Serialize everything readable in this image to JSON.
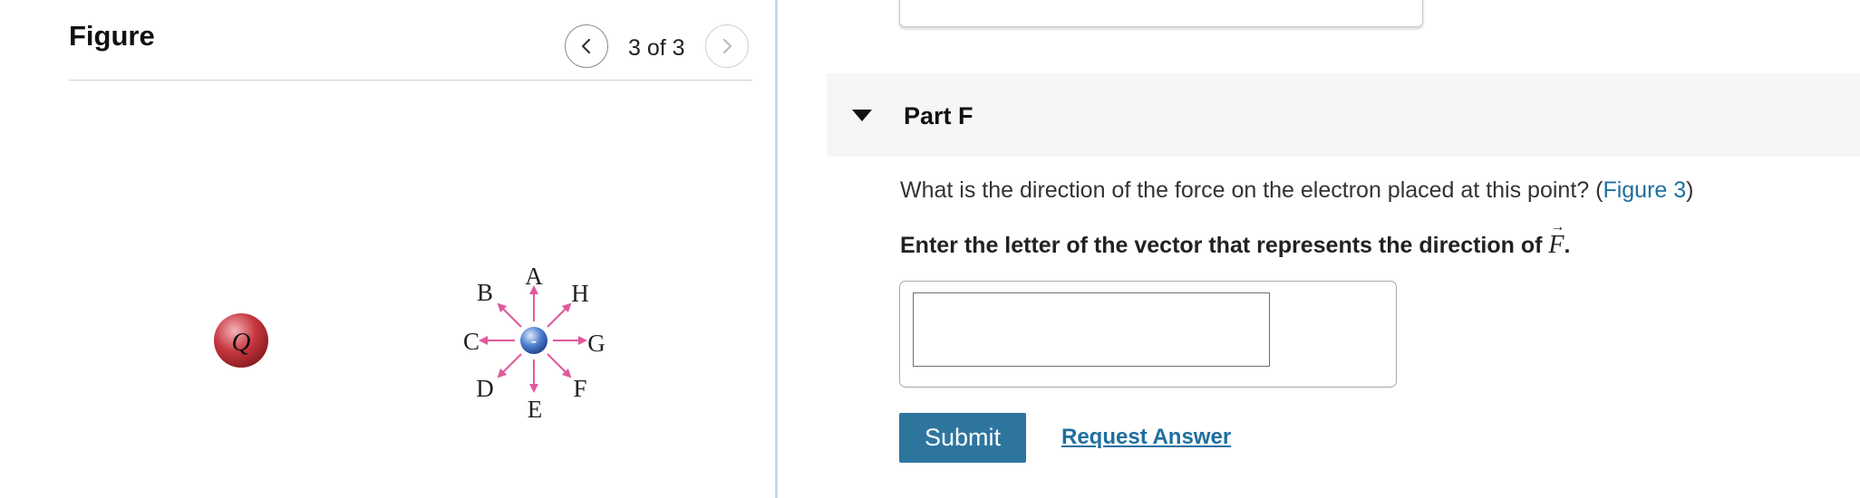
{
  "figure": {
    "title": "Figure",
    "counter": "3 of 3",
    "charge_label": "Q",
    "electron_sign": "-",
    "vector_labels": [
      "A",
      "B",
      "C",
      "D",
      "E",
      "F",
      "G",
      "H"
    ],
    "colors": {
      "charge": "#c7373f",
      "electron": "#4f7fd0",
      "arrow": "#e05a9c"
    }
  },
  "part": {
    "title": "Part F",
    "question_text": "What is the direction of the force on the electron placed at this point? (",
    "figure_link": "Figure 3",
    "question_end": ")",
    "instruction_text": "Enter the letter of the vector that represents the direction of ",
    "vector_symbol": "F",
    "vector_arrow": "→",
    "instruction_end": ".",
    "answer_value": ""
  },
  "actions": {
    "submit_label": "Submit",
    "request_label": "Request Answer"
  },
  "colors": {
    "accent": "#2e759e",
    "link": "#1f6f9e",
    "panel_divider": "#c9d7e6"
  }
}
